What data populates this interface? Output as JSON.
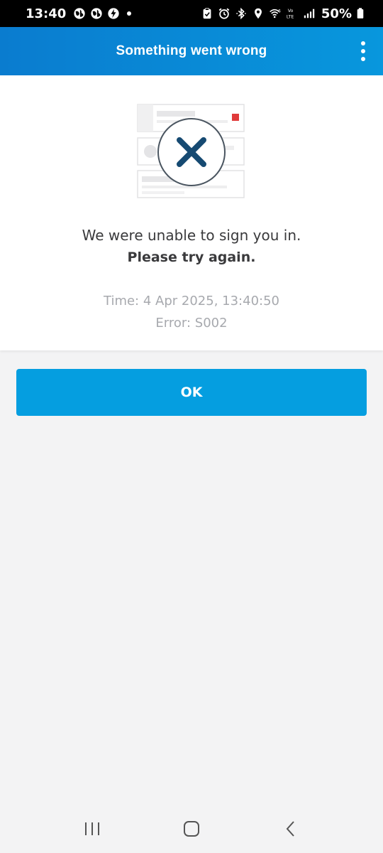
{
  "status_bar": {
    "time": "13:40",
    "battery_percent": "50%",
    "icons_left": [
      "globe-icon",
      "globe-icon",
      "bolt-icon"
    ],
    "icons_right": [
      "clipboard-icon",
      "alarm-icon",
      "bluetooth-icon",
      "location-icon",
      "wifi-icon",
      "volte-icon",
      "signal-icon",
      "battery-icon"
    ]
  },
  "app_bar": {
    "title": "Something went wrong",
    "menu_icon": "more-vert-icon",
    "background_color": "#0a8ad6"
  },
  "error_card": {
    "illustration_icon": "error-x-icon",
    "message_line1": "We were unable to sign you in.",
    "message_line2": "Please try again.",
    "time_label": "Time:",
    "time_value": "4 Apr 2025, 13:40:50",
    "error_label": "Error:",
    "error_value": "S002"
  },
  "actions": {
    "ok_label": "OK",
    "ok_color": "#059ee0"
  },
  "nav_bar": {
    "icons": [
      "recent-apps-icon",
      "home-icon",
      "back-icon"
    ]
  }
}
